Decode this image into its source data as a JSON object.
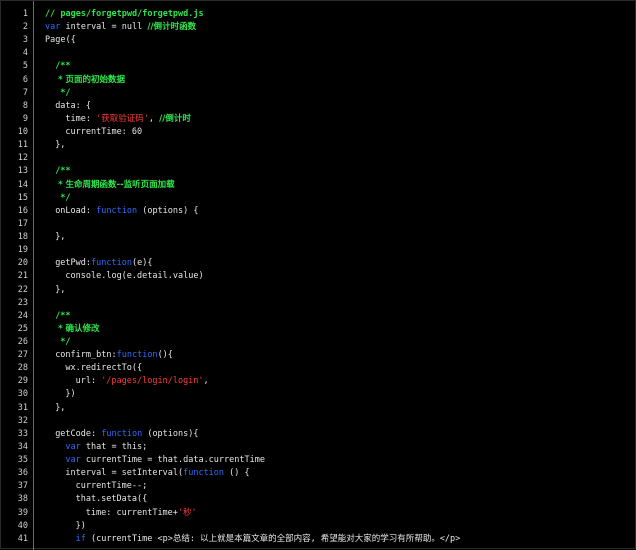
{
  "lines": [
    {
      "n": "1",
      "indent": 0,
      "tokens": [
        {
          "t": "cm",
          "v": "// pages/forgetpwd/forgetpwd.js"
        }
      ]
    },
    {
      "n": "2",
      "indent": 0,
      "tokens": [
        {
          "t": "kw",
          "v": "var"
        },
        {
          "t": "plain",
          "v": " interval = null "
        },
        {
          "t": "cm",
          "v": "//倒计时函数"
        }
      ]
    },
    {
      "n": "3",
      "indent": 0,
      "tokens": [
        {
          "t": "plain",
          "v": "Page({"
        }
      ]
    },
    {
      "n": "4",
      "indent": 0,
      "tokens": []
    },
    {
      "n": "5",
      "indent": 1,
      "tokens": [
        {
          "t": "cm",
          "v": "/**"
        }
      ]
    },
    {
      "n": "6",
      "indent": 1,
      "tokens": [
        {
          "t": "cm",
          "v": " * 页面的初始数据"
        }
      ]
    },
    {
      "n": "7",
      "indent": 1,
      "tokens": [
        {
          "t": "cm",
          "v": " */"
        }
      ]
    },
    {
      "n": "8",
      "indent": 1,
      "tokens": [
        {
          "t": "plain",
          "v": "data: {"
        }
      ]
    },
    {
      "n": "9",
      "indent": 2,
      "tokens": [
        {
          "t": "plain",
          "v": "time: "
        },
        {
          "t": "str",
          "v": "'获取验证码'"
        },
        {
          "t": "plain",
          "v": ", "
        },
        {
          "t": "cm",
          "v": "//倒计时"
        }
      ]
    },
    {
      "n": "10",
      "indent": 2,
      "tokens": [
        {
          "t": "plain",
          "v": "currentTime: 60"
        }
      ]
    },
    {
      "n": "11",
      "indent": 1,
      "tokens": [
        {
          "t": "plain",
          "v": "},"
        }
      ]
    },
    {
      "n": "12",
      "indent": 0,
      "tokens": []
    },
    {
      "n": "13",
      "indent": 1,
      "tokens": [
        {
          "t": "cm",
          "v": "/**"
        }
      ]
    },
    {
      "n": "14",
      "indent": 1,
      "tokens": [
        {
          "t": "cm",
          "v": " * 生命周期函数--监听页面加载"
        }
      ]
    },
    {
      "n": "15",
      "indent": 1,
      "tokens": [
        {
          "t": "cm",
          "v": " */"
        }
      ]
    },
    {
      "n": "16",
      "indent": 1,
      "tokens": [
        {
          "t": "plain",
          "v": "onLoad: "
        },
        {
          "t": "kw",
          "v": "function"
        },
        {
          "t": "plain",
          "v": " (options) {"
        }
      ]
    },
    {
      "n": "17",
      "indent": 0,
      "tokens": []
    },
    {
      "n": "18",
      "indent": 1,
      "tokens": [
        {
          "t": "plain",
          "v": "},"
        }
      ]
    },
    {
      "n": "19",
      "indent": 0,
      "tokens": []
    },
    {
      "n": "20",
      "indent": 1,
      "tokens": [
        {
          "t": "plain",
          "v": "getPwd:"
        },
        {
          "t": "kw",
          "v": "function"
        },
        {
          "t": "plain",
          "v": "(e){"
        }
      ]
    },
    {
      "n": "21",
      "indent": 2,
      "tokens": [
        {
          "t": "plain",
          "v": "console.log(e.detail.value)"
        }
      ]
    },
    {
      "n": "22",
      "indent": 1,
      "tokens": [
        {
          "t": "plain",
          "v": "},"
        }
      ]
    },
    {
      "n": "23",
      "indent": 0,
      "tokens": []
    },
    {
      "n": "24",
      "indent": 1,
      "tokens": [
        {
          "t": "cm",
          "v": "/**"
        }
      ]
    },
    {
      "n": "25",
      "indent": 1,
      "tokens": [
        {
          "t": "cm",
          "v": " * 确认修改"
        }
      ]
    },
    {
      "n": "26",
      "indent": 1,
      "tokens": [
        {
          "t": "cm",
          "v": " */"
        }
      ]
    },
    {
      "n": "27",
      "indent": 1,
      "tokens": [
        {
          "t": "plain",
          "v": "confirm_btn:"
        },
        {
          "t": "kw",
          "v": "function"
        },
        {
          "t": "plain",
          "v": "(){"
        }
      ]
    },
    {
      "n": "28",
      "indent": 2,
      "tokens": [
        {
          "t": "plain",
          "v": "wx.redirectTo({"
        }
      ]
    },
    {
      "n": "29",
      "indent": 3,
      "tokens": [
        {
          "t": "plain",
          "v": "url: "
        },
        {
          "t": "str",
          "v": "'/pages/login/login'"
        },
        {
          "t": "plain",
          "v": ","
        }
      ]
    },
    {
      "n": "30",
      "indent": 2,
      "tokens": [
        {
          "t": "plain",
          "v": "})"
        }
      ]
    },
    {
      "n": "31",
      "indent": 1,
      "tokens": [
        {
          "t": "plain",
          "v": "},"
        }
      ]
    },
    {
      "n": "32",
      "indent": 0,
      "tokens": []
    },
    {
      "n": "33",
      "indent": 1,
      "tokens": [
        {
          "t": "plain",
          "v": "getCode: "
        },
        {
          "t": "kw",
          "v": "function"
        },
        {
          "t": "plain",
          "v": " (options){"
        }
      ]
    },
    {
      "n": "34",
      "indent": 2,
      "tokens": [
        {
          "t": "kw",
          "v": "var"
        },
        {
          "t": "plain",
          "v": " that = this;"
        }
      ]
    },
    {
      "n": "35",
      "indent": 2,
      "tokens": [
        {
          "t": "kw",
          "v": "var"
        },
        {
          "t": "plain",
          "v": " currentTime = that.data.currentTime"
        }
      ]
    },
    {
      "n": "36",
      "indent": 2,
      "tokens": [
        {
          "t": "plain",
          "v": "interval = setInterval("
        },
        {
          "t": "kw",
          "v": "function"
        },
        {
          "t": "plain",
          "v": " () {"
        }
      ]
    },
    {
      "n": "37",
      "indent": 3,
      "tokens": [
        {
          "t": "plain",
          "v": "currentTime--;"
        }
      ]
    },
    {
      "n": "38",
      "indent": 3,
      "tokens": [
        {
          "t": "plain",
          "v": "that.setData({"
        }
      ]
    },
    {
      "n": "39",
      "indent": 4,
      "tokens": [
        {
          "t": "plain",
          "v": "time: currentTime+"
        },
        {
          "t": "str",
          "v": "'秒'"
        }
      ]
    },
    {
      "n": "40",
      "indent": 3,
      "tokens": [
        {
          "t": "plain",
          "v": "})"
        }
      ]
    },
    {
      "n": "41",
      "indent": 3,
      "tokens": [
        {
          "t": "kw",
          "v": "if"
        },
        {
          "t": "plain",
          "v": " (currentTime <p>总结: 以上就是本篇文章的全部内容, 希望能对大家的学习有所帮助。</p>"
        }
      ]
    }
  ]
}
